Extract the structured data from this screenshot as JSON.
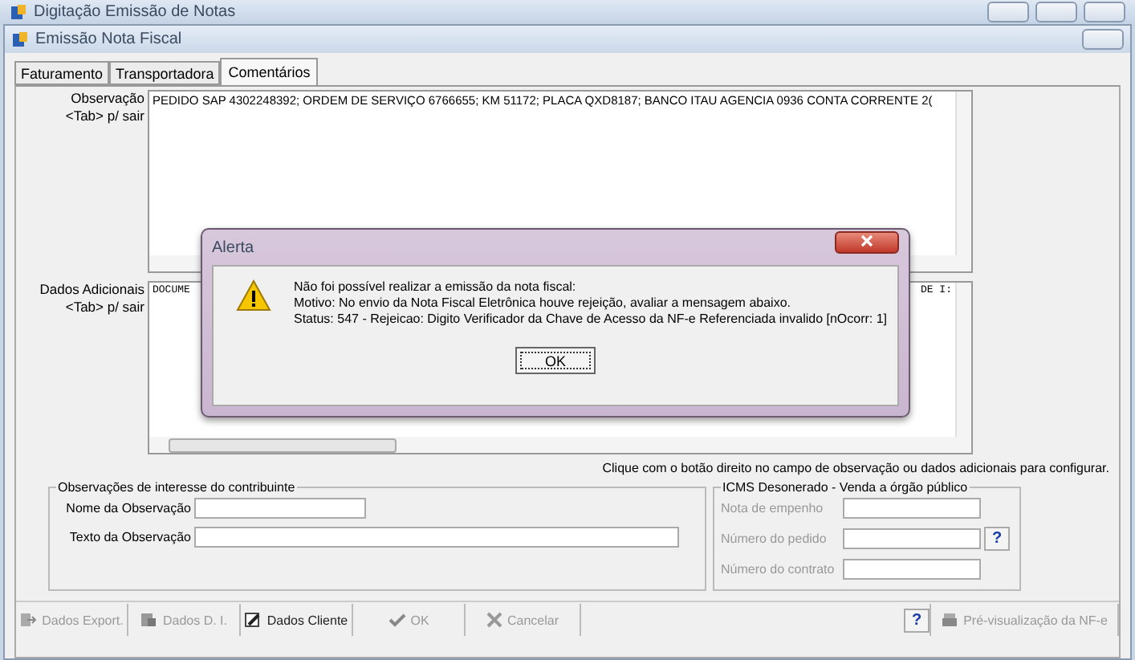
{
  "outer_window": {
    "title": "Digitação Emissão de Notas"
  },
  "window": {
    "title": "Emissão Nota Fiscal"
  },
  "tabs": [
    {
      "label": "Faturamento",
      "selected": false
    },
    {
      "label": "Transportadora",
      "selected": false
    },
    {
      "label": "Comentários",
      "selected": true
    }
  ],
  "observacao": {
    "label": "Observação",
    "hint": "<Tab> p/ sair",
    "value": "PEDIDO SAP 4302248392; ORDEM DE SERVIÇO 6766655; KM 51172; PLACA  QXD8187; BANCO ITAU  AGENCIA  0936   CONTA CORRENTE 2("
  },
  "dados_adicionais": {
    "label": "Dados Adicionais",
    "hint": "<Tab> p/ sair",
    "visible_start": "DOCUME",
    "visible_end": "DE I:"
  },
  "help_text": "Clique com o botão direito no campo de observação ou dados adicionais para configurar.",
  "contribuinte": {
    "title": "Observações de interesse do contribuinte",
    "fields": [
      {
        "label": "Nome da Observação",
        "kind": "short"
      },
      {
        "label": "Texto da Observação",
        "kind": "long"
      }
    ]
  },
  "icms": {
    "title": "ICMS Desonerado - Venda a órgão público",
    "fields": [
      {
        "label": "Nota de empenho",
        "kind": "plain"
      },
      {
        "label": "Número do pedido",
        "kind": "help"
      },
      {
        "label": "Número do contrato",
        "kind": "plain"
      }
    ]
  },
  "footer_buttons": [
    {
      "label": "Dados Export.",
      "kind": "export",
      "disabled": true
    },
    {
      "label": "Dados D. I.",
      "kind": "doc",
      "disabled": true
    },
    {
      "label": "Dados Cliente",
      "kind": "edit",
      "disabled": false
    },
    {
      "label": "OK",
      "kind": "check",
      "disabled": true
    },
    {
      "label": "Cancelar",
      "kind": "cross",
      "disabled": true
    }
  ],
  "help_button": "?",
  "preview_button": {
    "label": "Pré-visualização da NF-e",
    "disabled": true
  },
  "dialog": {
    "title": "Alerta",
    "lines": [
      "Não foi possível realizar a emissão da nota fiscal:",
      "Motivo: No envio da Nota Fiscal Eletrônica houve rejeição, avaliar a mensagem abaixo.",
      "Status: 547 - Rejeicao: Digito Verificador da Chave de Acesso da NF-e Referenciada invalido [nOcorr: 1]"
    ],
    "button": "OK"
  }
}
